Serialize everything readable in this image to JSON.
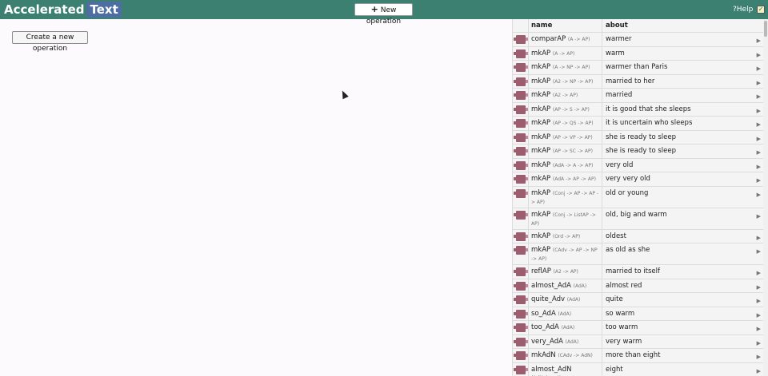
{
  "header": {
    "logo_part1": "Accelerated",
    "logo_part2": "Text",
    "new_operation_label": "New operation",
    "help_label": "Help",
    "checkbox_checked": "✓"
  },
  "main": {
    "create_button_label": "Create a new operation"
  },
  "table": {
    "columns": {
      "name": "name",
      "about": "about"
    },
    "rows": [
      {
        "name": "comparAP",
        "type": "(A -> AP)",
        "about": "warmer"
      },
      {
        "name": "mkAP",
        "type": "(A -> AP)",
        "about": "warm"
      },
      {
        "name": "mkAP",
        "type": "(A -> NP -> AP)",
        "about": "warmer than Paris"
      },
      {
        "name": "mkAP",
        "type": "(A2 -> NP -> AP)",
        "about": "married to her"
      },
      {
        "name": "mkAP",
        "type": "(A2 -> AP)",
        "about": "married"
      },
      {
        "name": "mkAP",
        "type": "(AP -> S -> AP)",
        "about": "it is good that she sleeps"
      },
      {
        "name": "mkAP",
        "type": "(AP -> QS -> AP)",
        "about": "it is uncertain who sleeps"
      },
      {
        "name": "mkAP",
        "type": "(AP -> VP -> AP)",
        "about": "she is ready to sleep"
      },
      {
        "name": "mkAP",
        "type": "(AP -> SC -> AP)",
        "about": "she is ready to sleep"
      },
      {
        "name": "mkAP",
        "type": "(AdA -> A -> AP)",
        "about": "very old"
      },
      {
        "name": "mkAP",
        "type": "(AdA -> AP -> AP)",
        "about": "very very old"
      },
      {
        "name": "mkAP",
        "type": "(Conj -> AP -> AP -> AP)",
        "about": "old or young"
      },
      {
        "name": "mkAP",
        "type": "(Conj -> ListAP -> AP)",
        "about": "old, big and warm"
      },
      {
        "name": "mkAP",
        "type": "(Ord -> AP)",
        "about": "oldest"
      },
      {
        "name": "mkAP",
        "type": "(CAdv -> AP -> NP -> AP)",
        "about": "as old as she"
      },
      {
        "name": "reflAP",
        "type": "(A2 -> AP)",
        "about": "married to itself"
      },
      {
        "name": "almost_AdA",
        "type": "(AdA)",
        "about": "almost red"
      },
      {
        "name": "quite_Adv",
        "type": "(AdA)",
        "about": "quite"
      },
      {
        "name": "so_AdA",
        "type": "(AdA)",
        "about": "so warm"
      },
      {
        "name": "too_AdA",
        "type": "(AdA)",
        "about": "too warm"
      },
      {
        "name": "very_AdA",
        "type": "(AdA)",
        "about": "very warm"
      },
      {
        "name": "mkAdN",
        "type": "(CAdv -> AdN)",
        "about": "more than eight"
      },
      {
        "name": "almost_AdN",
        "type": "(AdNalmost)",
        "about": "eight"
      }
    ],
    "row_arrow": "▶"
  }
}
